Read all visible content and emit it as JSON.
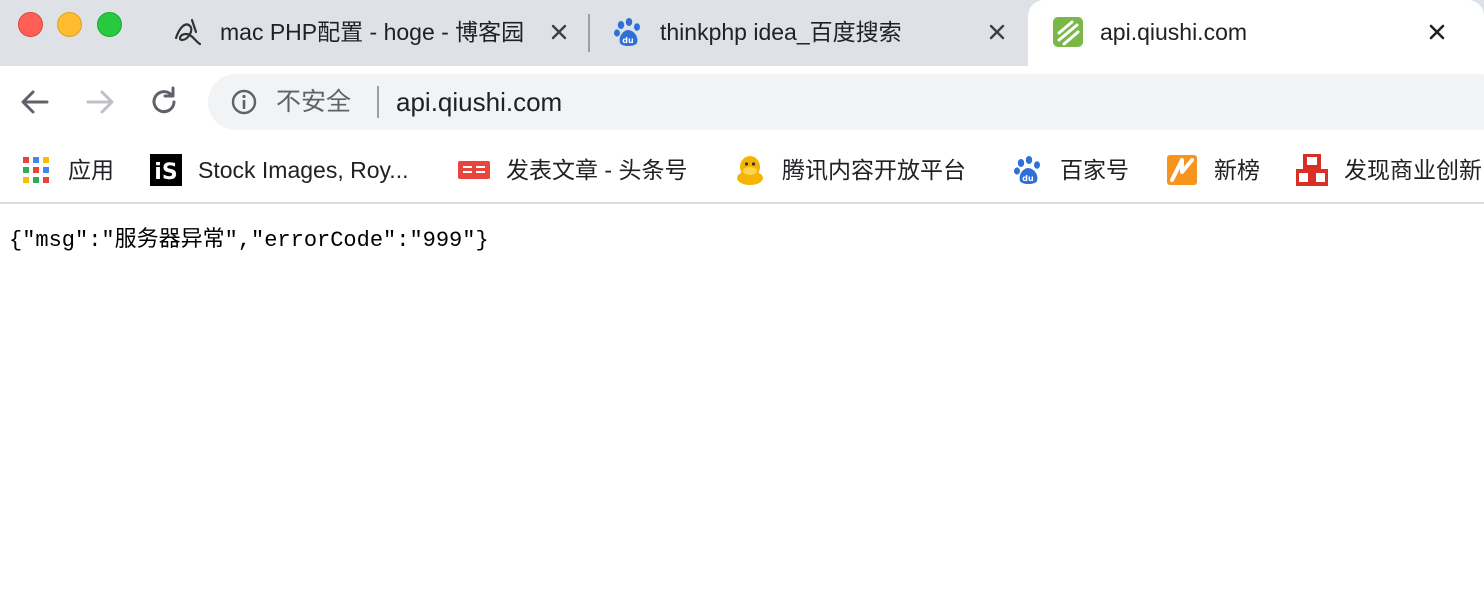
{
  "tabs": [
    {
      "title": "mac PHP配置 - hoge - 博客园",
      "favicon": "cnblogs-icon",
      "active": false
    },
    {
      "title": "thinkphp idea_百度搜索",
      "favicon": "baidu-paw-icon",
      "active": false
    },
    {
      "title": "api.qiushi.com",
      "favicon": "qiushi-logo-icon",
      "active": true
    }
  ],
  "toolbar": {
    "back_icon": "arrow-left-icon",
    "forward_icon": "arrow-right-icon",
    "reload_icon": "reload-icon"
  },
  "omnibox": {
    "security_label": "不安全",
    "url": "api.qiushi.com"
  },
  "bookmarks": [
    {
      "label": "应用",
      "icon": "apps-grid-icon"
    },
    {
      "label": "Stock Images, Roy...",
      "icon": "istock-icon"
    },
    {
      "label": "发表文章 - 头条号",
      "icon": "toutiao-icon"
    },
    {
      "label": "腾讯内容开放平台",
      "icon": "qq-penguin-icon"
    },
    {
      "label": "百家号",
      "icon": "baidu-paw-icon"
    },
    {
      "label": "新榜",
      "icon": "xinbang-icon"
    },
    {
      "label": "发现商业创新",
      "icon": "red-blocks-icon"
    }
  ],
  "page": {
    "body_text": "{\"msg\":\"服务器异常\",\"errorCode\":\"999\"}"
  },
  "colors": {
    "tabstrip": "#dee1e6",
    "omnibox": "#f1f3f4",
    "traffic_close": "#ff5f57",
    "traffic_min": "#febc2e",
    "traffic_max": "#28c840"
  }
}
